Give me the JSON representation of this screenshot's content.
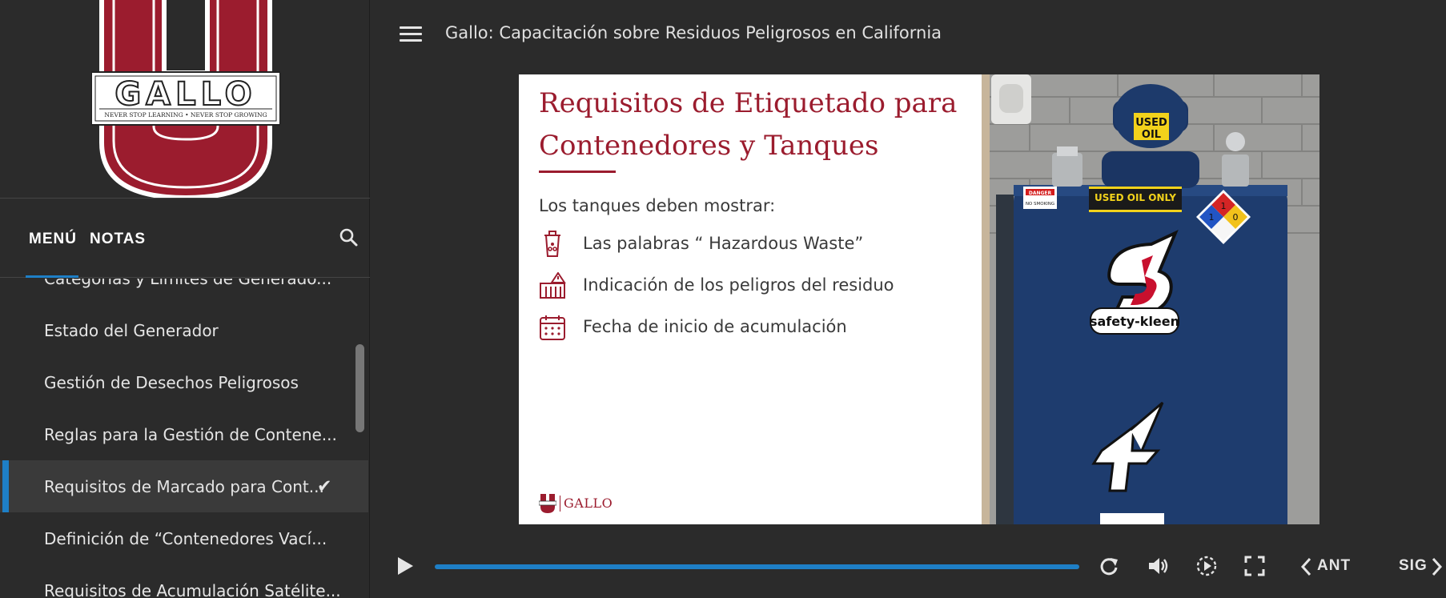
{
  "brand": {
    "logo_word": "GALLO",
    "logo_tagline": "NEVER STOP LEARNING • NEVER STOP GROWING",
    "primary_color": "#9b1c2e",
    "accent_color": "#1e7fc6"
  },
  "sidebar": {
    "tabs": [
      {
        "label": "MENÚ",
        "active": true
      },
      {
        "label": "NOTAS",
        "active": false
      }
    ],
    "search_icon": "search-icon",
    "items": [
      {
        "label": "Categorías y Límites de Generado...",
        "active": false,
        "completed": false
      },
      {
        "label": "Estado del Generador",
        "active": false,
        "completed": false
      },
      {
        "label": "Gestión de Desechos Peligrosos",
        "active": false,
        "completed": false
      },
      {
        "label": "Reglas para la Gestión de Contene...",
        "active": false,
        "completed": false
      },
      {
        "label": "Requisitos de Marcado para Cont...",
        "active": true,
        "completed": true
      },
      {
        "label": "Definición de “Contenedores Vací...",
        "active": false,
        "completed": false
      },
      {
        "label": "Requisitos de Acumulación Satélite...",
        "active": false,
        "completed": false
      }
    ]
  },
  "header": {
    "menu_icon": "hamburger-icon",
    "course_title": "Gallo: Capacitación sobre Residuos Peligrosos en California"
  },
  "slide": {
    "title": "Requisitos de Etiquetado para Contenedores y Tanques",
    "intro": "Los tanques deben mostrar:",
    "bullets": [
      {
        "icon": "hazardous-container-icon",
        "text": "Las palabras “ Hazardous Waste”"
      },
      {
        "icon": "hazard-warning-icon",
        "text": "Indicación de los peligros del residuo"
      },
      {
        "icon": "calendar-icon",
        "text": "Fecha de inicio de acumulación"
      }
    ],
    "footer_logo": "GALLO",
    "photo": {
      "description_icon": "used-oil-tank-photo",
      "cap_label_line1": "USED",
      "cap_label_line2": "OIL",
      "tank_sign": "USED OIL ONLY",
      "danger_sign_title": "DANGER",
      "danger_sign_text": "NO SMOKING",
      "nfpa": [
        "1",
        "1",
        "0"
      ],
      "brand_text": "safety-kleen"
    }
  },
  "player": {
    "progress": 1.0,
    "prev_label": "ANT",
    "next_label": "SIG"
  }
}
